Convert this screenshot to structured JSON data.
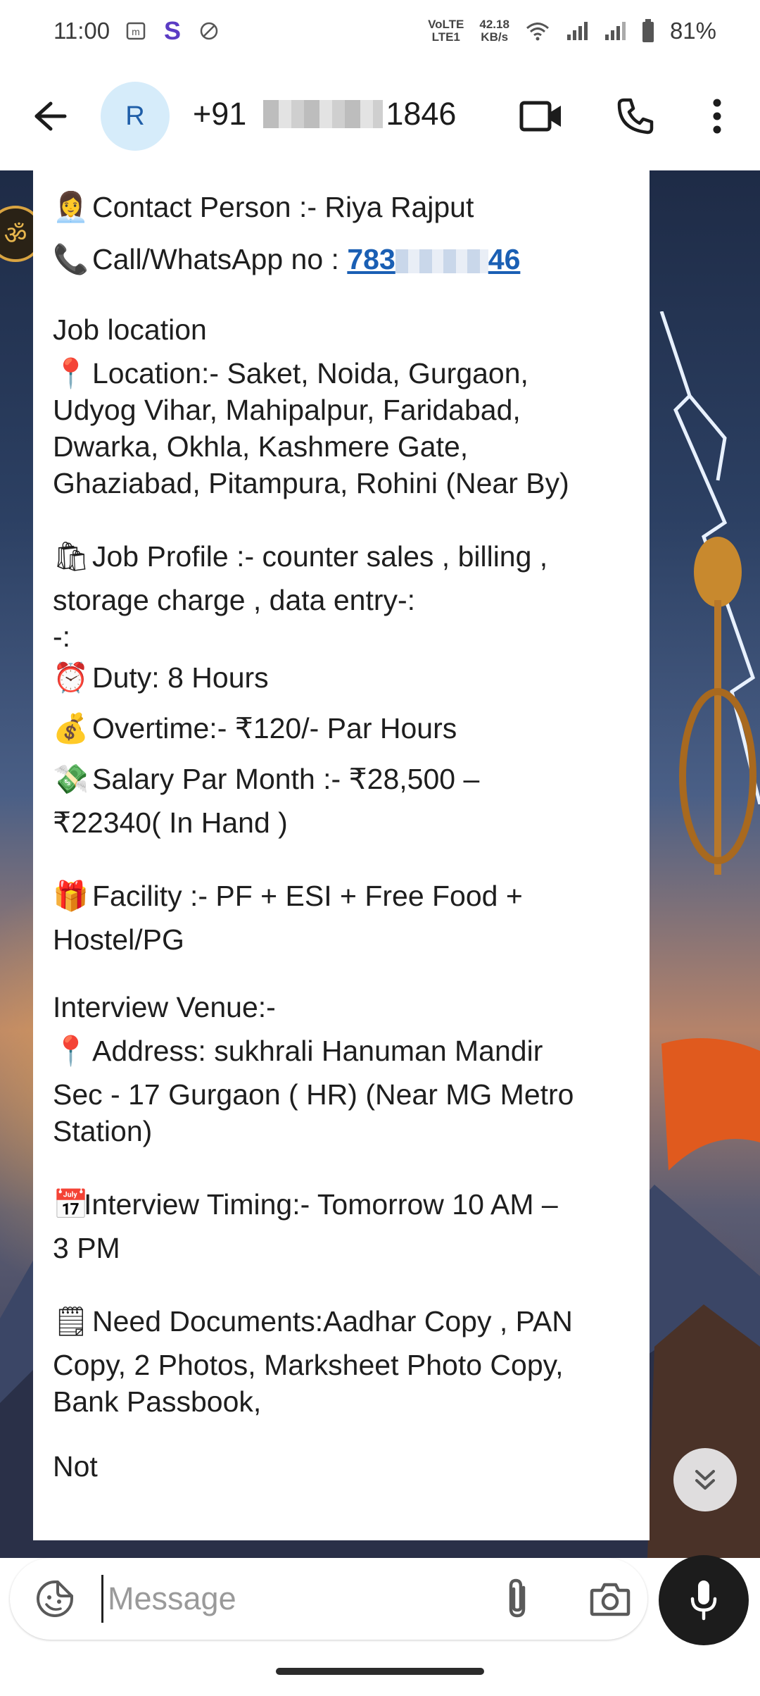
{
  "status_bar": {
    "time": "11:00",
    "network_label_top": "VoLTE",
    "network_label_bottom": "LTE1",
    "speed_value": "42.18",
    "speed_unit": "KB/s",
    "battery": "81%",
    "icons": [
      "messages-icon",
      "s-app-icon",
      "do-not-disturb-icon",
      "wifi-icon",
      "signal-icon",
      "signal-icon",
      "battery-icon"
    ]
  },
  "header": {
    "avatar_letter": "R",
    "contact_prefix": "+91",
    "contact_suffix": "1846"
  },
  "message": {
    "contact_person": "Contact Person :-  Riya Rajput",
    "call_label": "Call/WhatsApp no : ",
    "call_number_start": "783",
    "call_number_end": "46",
    "job_location_heading": "Job location",
    "location_lines": [
      "Location:- Saket, Noida, Gurgaon,",
      "Udyog Vihar, Mahipalpur, Faridabad,",
      "Dwarka, Okhla, Kashmere Gate,",
      "Ghaziabad, Pitampura, Rohini (Near By)"
    ],
    "job_profile_lines": [
      "Job Profile :- counter sales , billing ,",
      "storage charge , data entry-:",
      "-:"
    ],
    "duty": "Duty: 8 Hours",
    "overtime": "Overtime:-  ₹120/- Par Hours",
    "salary_lines": [
      "Salary Par Month :- ₹28,500 –",
      "₹22340( In Hand )"
    ],
    "facility_lines": [
      "Facility :- PF + ESI + Free Food +",
      "Hostel/PG"
    ],
    "venue_heading": "Interview Venue:-",
    "address_lines": [
      "Address: sukhrali Hanuman Mandir",
      "Sec - 17 Gurgaon ( HR) (Near MG Metro",
      "Station)"
    ],
    "timing_lines": [
      "Interview Timing:-  Tomorrow 10 AM –",
      "3 PM"
    ],
    "documents_lines": [
      "Need Documents:Aadhar Copy , PAN",
      "Copy, 2 Photos, Marksheet Photo Copy,",
      "Bank Passbook,"
    ],
    "cut_off_text": "Not"
  },
  "composer": {
    "placeholder": "Message"
  },
  "colors": {
    "link": "#1a5fb4",
    "avatar_bg": "#d6ecfa",
    "avatar_fg": "#1f5ea8",
    "mic_bg": "#1c1c1c"
  }
}
